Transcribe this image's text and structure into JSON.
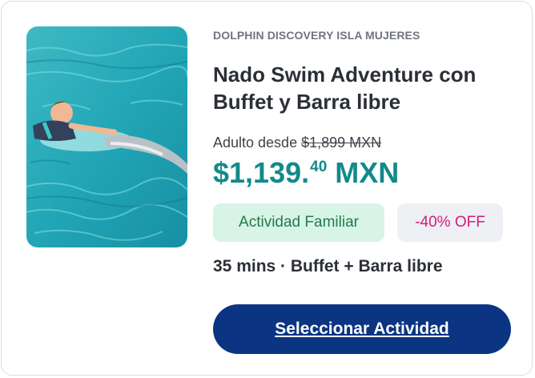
{
  "card": {
    "image": {
      "icon": "photo-boy-swimming-with-dolphin"
    },
    "operator": "DOLPHIN DISCOVERY ISLA MUJERES",
    "title": "Nado Swim Adventure con Buffet y Barra libre",
    "pricing": {
      "from_label": "Adulto desde",
      "original_price": "$1,899 MXN",
      "price_main": "$1,139.",
      "price_cents": "40",
      "price_currency": " MXN"
    },
    "badges": {
      "category": "Actividad Familiar",
      "discount": "-40% OFF"
    },
    "details": "35 mins · Buffet + Barra libre",
    "cta_label": "Seleccionar Actividad"
  },
  "colors": {
    "price": "#138a8a",
    "cta_background": "#0b3582",
    "category_badge_bg": "#d8f4e6",
    "category_badge_text": "#237a4e",
    "discount_text": "#d11c7a"
  }
}
